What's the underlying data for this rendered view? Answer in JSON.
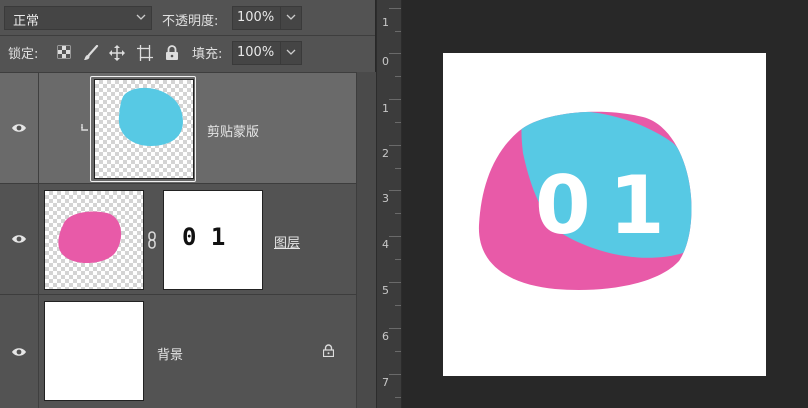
{
  "options": {
    "blend_mode": "正常",
    "opacity_label": "不透明度:",
    "opacity_value": "100%",
    "lock_label": "锁定:",
    "fill_label": "填充:",
    "fill_value": "100%"
  },
  "layers": [
    {
      "name": "剪贴蒙版",
      "fill_color": "#57c9e4"
    },
    {
      "name": "图层",
      "mask_text": "0 1",
      "fill_color": "#e85aa8"
    },
    {
      "name": "背景"
    }
  ],
  "ruler": {
    "numbers": [
      "1",
      "0",
      "1",
      "2",
      "3",
      "4",
      "5",
      "6",
      "7"
    ]
  },
  "canvas": {
    "text_0": "0",
    "text_1": "1",
    "pink": "#e85aa8",
    "cyan": "#57c9e4"
  }
}
